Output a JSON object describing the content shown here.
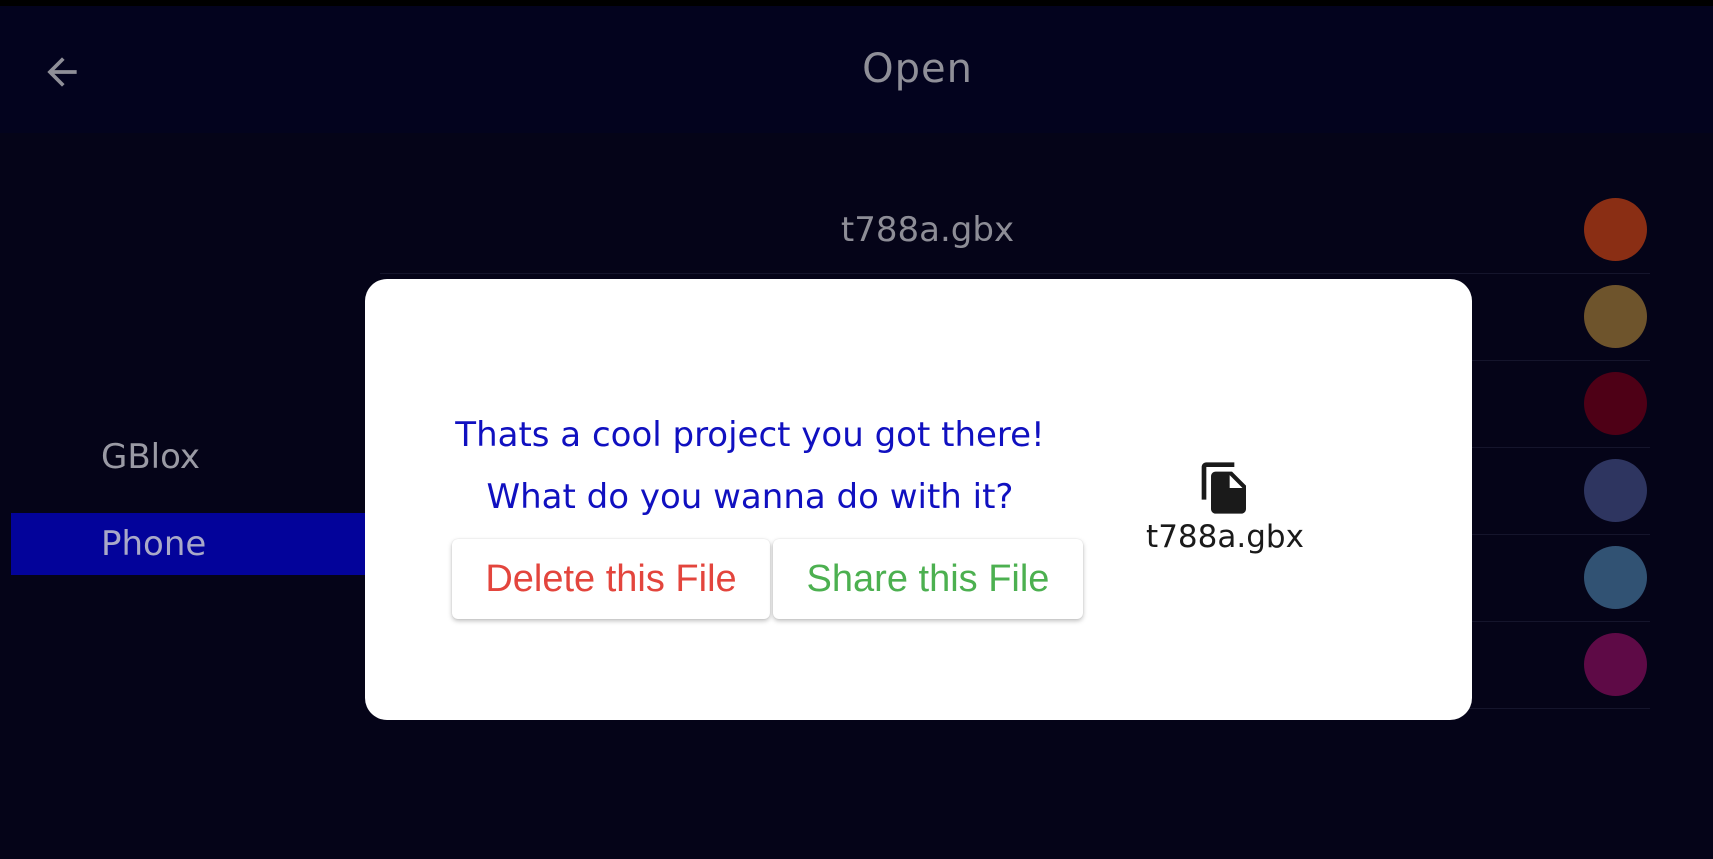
{
  "header": {
    "title": "Open",
    "back_icon": "arrow-left-icon"
  },
  "sidebar": {
    "items": [
      {
        "label": "GBlox",
        "selected": false
      },
      {
        "label": "Phone",
        "selected": true
      }
    ],
    "selected_color": "#03039a"
  },
  "file_list": {
    "items": [
      {
        "name": "t788a.gbx",
        "color": "#8a2e14"
      },
      {
        "name": "",
        "color": "#6e542c"
      },
      {
        "name": "",
        "color": "#4e0016"
      },
      {
        "name": "",
        "color": "#2e3560"
      },
      {
        "name": "",
        "color": "#315273"
      },
      {
        "name": "",
        "color": "#5e0a46"
      }
    ]
  },
  "dialog": {
    "message_line1": "Thats a cool project you got there!",
    "message_line2": "What do you wanna do with it?",
    "delete_label": "Delete this File",
    "share_label": "Share this File",
    "file_icon": "file-copy-icon",
    "file_name": "t788a.gbx",
    "colors": {
      "message": "#1010c0",
      "delete": "#e3453d",
      "share": "#4cb050"
    }
  }
}
